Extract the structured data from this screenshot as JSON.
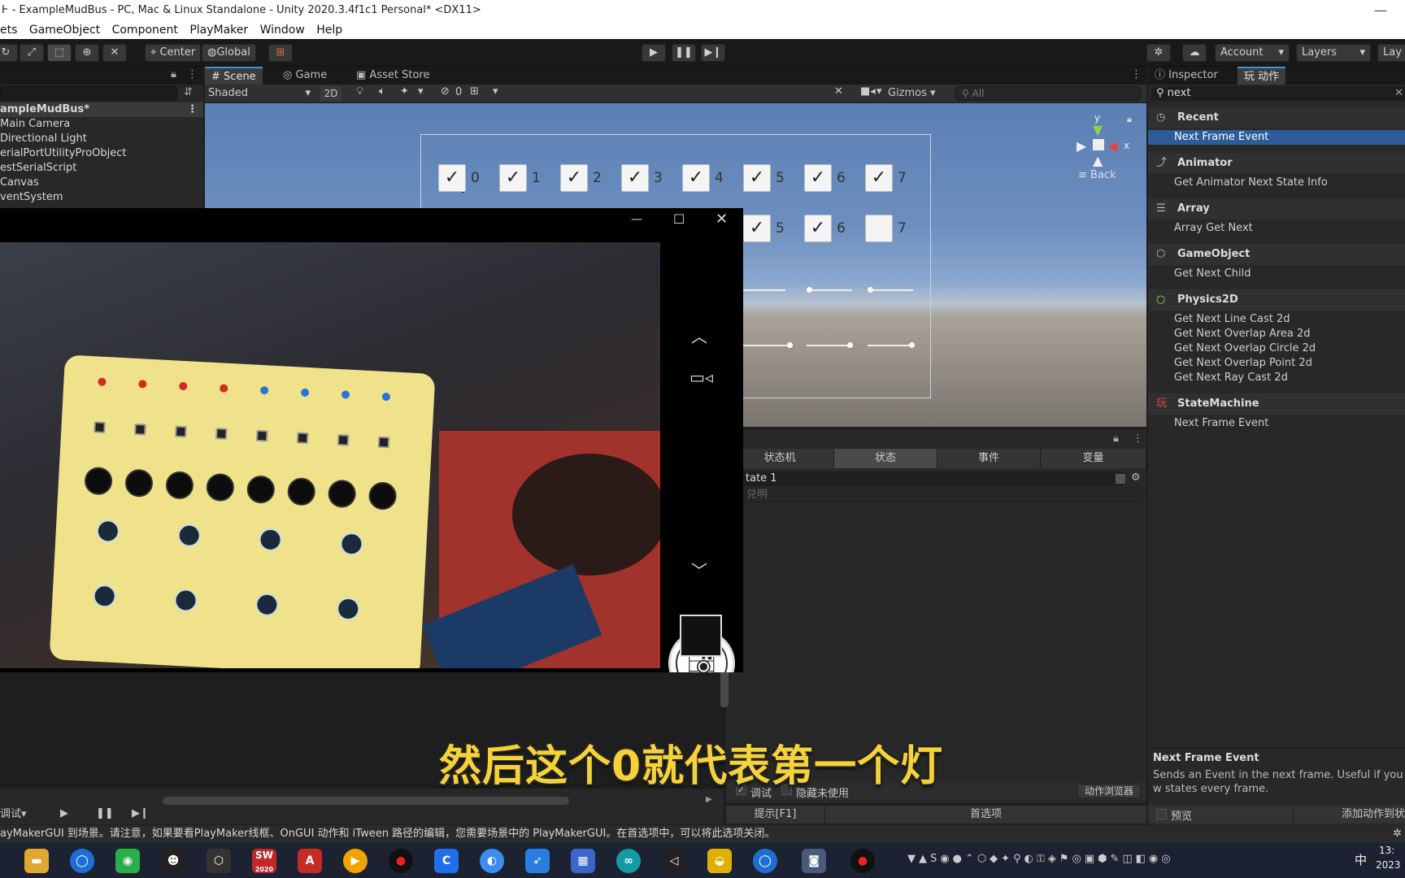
{
  "window": {
    "title": "Ͱ - ExampleMudBus - PC, Mac & Linux Standalone - Unity 2020.3.4f1c1 Personal* <DX11>",
    "minimize_glyph": "—"
  },
  "menu": [
    "ets",
    "GameObject",
    "Component",
    "PlayMaker",
    "Window",
    "Help"
  ],
  "toolbar": {
    "pivot": "Center",
    "space": "Global",
    "account": "Account",
    "layers": "Layers",
    "layout": "Lay"
  },
  "hierarchy": {
    "scene": "ampleMudBus*",
    "items": [
      "Main Camera",
      "Directional Light",
      "erialPortUtilityProObject",
      "estSerialScript",
      "Canvas",
      "ventSystem"
    ]
  },
  "scene_tabs": {
    "scene": "Scene",
    "game": "Game",
    "asset_store": "Asset Store"
  },
  "scene_toolbar": {
    "shading": "Shaded",
    "mode_2d": "2D",
    "hidden_count": "0",
    "gizmos": "Gizmos",
    "search_placeholder": "All"
  },
  "scene_checkboxes": {
    "row1": [
      {
        "label": "0",
        "checked": true
      },
      {
        "label": "1",
        "checked": true
      },
      {
        "label": "2",
        "checked": true
      },
      {
        "label": "3",
        "checked": true
      },
      {
        "label": "4",
        "checked": true
      },
      {
        "label": "5",
        "checked": true
      },
      {
        "label": "6",
        "checked": true
      },
      {
        "label": "7",
        "checked": true
      }
    ],
    "row2": [
      {
        "label": "5",
        "checked": true
      },
      {
        "label": "6",
        "checked": true
      },
      {
        "label": "7",
        "checked": false
      }
    ]
  },
  "gizmo": {
    "y_axis": "y",
    "x_axis": "x",
    "back": "Back"
  },
  "fsm": {
    "tabs": [
      "状态机",
      "状态",
      "事件",
      "变量"
    ],
    "state_name": "tate 1",
    "description_placeholder": "兑明",
    "debug_label": "调试",
    "hide_unused_label": "隐藏未使用",
    "action_browser": "动作浏览器",
    "hint": "提示[F1]",
    "preferences": "首选项"
  },
  "playback": {
    "debug": "调试"
  },
  "inspector": {
    "tabs": [
      "Inspector",
      "动作"
    ],
    "search_value": "next",
    "categories": [
      {
        "icon": "◷",
        "name": "Recent",
        "items": [
          "Next Frame Event"
        ],
        "selected": 0
      },
      {
        "icon": "⤴",
        "name": "Animator",
        "items": [
          "Get Animator Next State Info"
        ]
      },
      {
        "icon": "☰",
        "name": "Array",
        "items": [
          "Array Get Next"
        ]
      },
      {
        "icon": "⬡",
        "name": "GameObject",
        "items": [
          "Get Next Child"
        ]
      },
      {
        "icon": "○",
        "name": "Physics2D",
        "items": [
          "Get Next Line Cast 2d",
          "Get Next Overlap Area 2d",
          "Get Next Overlap Circle 2d",
          "Get Next Overlap Point 2d",
          "Get Next Ray Cast 2d"
        ]
      },
      {
        "icon": "玩",
        "name": "StateMachine",
        "items": [
          "Next Frame Event"
        ]
      }
    ],
    "detail_title": "Next Frame Event",
    "detail_desc": "Sends an Event in the next frame. Useful if you w states every frame.",
    "preview": "预览",
    "add_action": "添加动作到状"
  },
  "subtitle": "然后这个0就代表第一个灯",
  "status": "ayMakerGUI 到场景。请注意，如果要看PlayMaker线框、OnGUI 动作和 iTween 路径的编辑，您需要场景中的 PlayMakerGUI。在首选项中，可以将此选项关闭。",
  "taskbar": {
    "apps": [
      "explorer",
      "search",
      "wechat",
      "qq",
      "unity",
      "solidworks",
      "autocad",
      "player",
      "record",
      "c-app",
      "browser",
      "feishu",
      "calc",
      "arduino",
      "vs",
      "duck",
      "search2",
      "camera",
      "record2"
    ],
    "solidworks_label": "SW",
    "solidworks_year": "2020",
    "autocad_label": "A",
    "clock_time": "13:",
    "clock_date": "2023",
    "ime": "中"
  },
  "colors": {
    "selection": "#2c5d9a",
    "subtitle": "#f6d23a",
    "accent_tab": "#4a8fd6"
  }
}
